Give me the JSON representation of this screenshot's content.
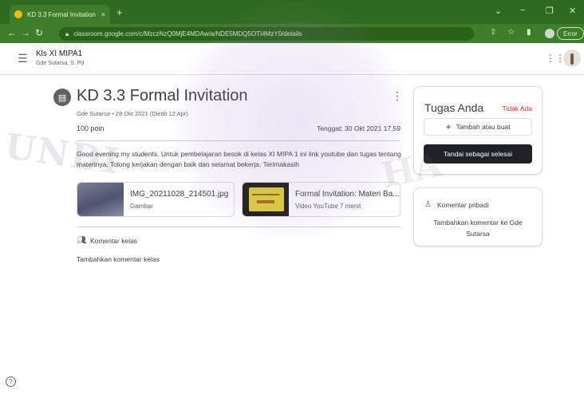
{
  "browser": {
    "tab_title": "KD 3.3 Formal Invitation",
    "tab_close": "×",
    "new_tab": "+",
    "url": "classroom.google.com/c/MzczNzQ0MjE4MDAw/a/NDE5MDQ5OTI4MzY0/details",
    "error_label": "Error",
    "window_controls": [
      "⌄",
      "−",
      "❐",
      "✕"
    ]
  },
  "app": {
    "class_name": "Kls XI MIPA1",
    "teacher": "Gde Sutarsa, S. Pd"
  },
  "assignment": {
    "title": "KD 3.3 Formal Invitation",
    "meta": "Gde Sutarsa • 28 Okt 2021 (Diedit 12 Apr)",
    "points": "100 poin",
    "due": "Tenggat: 30 Okt 2021 17.59",
    "description": "Good evening my students. Untuk pembelajaran besok di kelas XI MIPA 1 ini link youtube dan tugas tentang materinya. Tolong kerjakan dengan baik dan selamat bekerja. Terimakasih",
    "attachments": [
      {
        "name": "IMG_20211028_214501.jpg",
        "type": "Gambar"
      },
      {
        "name": "Formal Invitation: Materi Ba...",
        "type": "Video YouTube  7 menit"
      }
    ]
  },
  "class_comments": {
    "label": "Komentar kelas",
    "add": "Tambahkan komentar kelas"
  },
  "your_work": {
    "title": "Tugas Anda",
    "status": "Tidak Ada",
    "add_button": "Tambah atau buat",
    "done_button": "Tandai sebagai selesai"
  },
  "private_comments": {
    "title": "Komentar pribadi",
    "add": "Tambahkan komentar ke Gde Sutarsa"
  },
  "watermark": {
    "left": "UNDI",
    "right": "HA"
  },
  "colors": {
    "browser_theme": "#2f6b1f",
    "status_missing": "#d93025",
    "done_button": "#202124"
  }
}
